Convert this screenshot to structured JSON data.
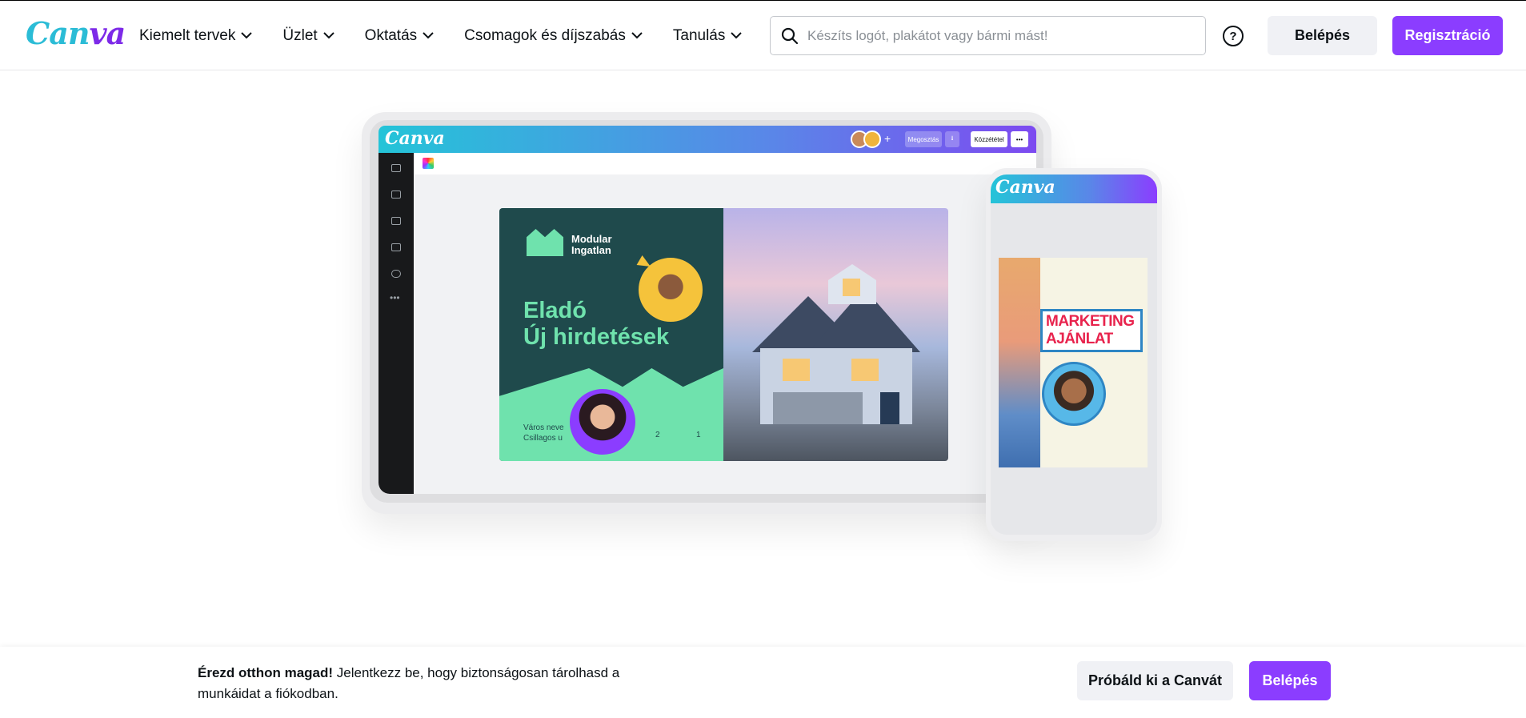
{
  "header": {
    "logo": {
      "part1": "Can",
      "part2": "va"
    },
    "nav": [
      {
        "label": "Kiemelt tervek"
      },
      {
        "label": "Üzlet"
      },
      {
        "label": "Oktatás"
      },
      {
        "label": "Csomagok és díjszabás"
      },
      {
        "label": "Tanulás"
      }
    ],
    "search": {
      "placeholder": "Készíts logót, plakátot vagy bármi mást!"
    },
    "help": "?",
    "login_label": "Belépés",
    "register_label": "Regisztráció"
  },
  "hero": {
    "editor": {
      "logo": "Canva",
      "share_label": "Megosztás",
      "publish_label": "Közzététel",
      "more_label": "•••"
    },
    "design": {
      "brand_name": "Modular Ingatlan",
      "title_line1": "Eladó",
      "title_line2": "Új hirdetések",
      "address_line1": "Város neve",
      "address_line2": "Csillagos u",
      "bath_count": "2",
      "car_count": "1"
    },
    "phone": {
      "logo": "Canva",
      "card_line1": "MARKETING",
      "card_line2": "AJÁNLAT"
    }
  },
  "banner": {
    "bold_text": "Érezd otthon magad!",
    "text": " Jelentkezz be, hogy biztonságosan tárolhasd a munkáidat a fiókodban.",
    "try_label": "Próbáld ki a Canvát",
    "login_label": "Belépés"
  },
  "colors": {
    "brand_purple": "#8b3dff",
    "brand_cyan": "#24c4d8",
    "button_grey": "#f0f1f5"
  }
}
